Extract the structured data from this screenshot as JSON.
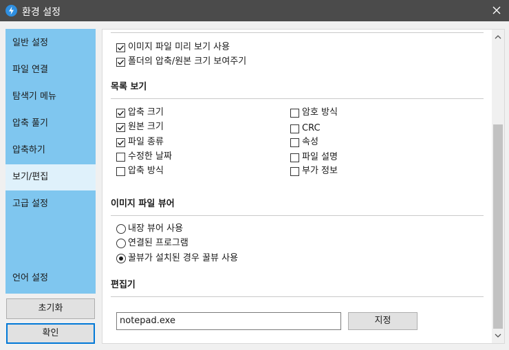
{
  "window": {
    "title": "환경 설정",
    "app_icon": "bandizip-icon",
    "close_icon": "close-icon"
  },
  "sidebar": {
    "items": [
      {
        "label": "일반 설정",
        "active": false
      },
      {
        "label": "파일 연결",
        "active": false
      },
      {
        "label": "탐색기 메뉴",
        "active": false
      },
      {
        "label": "압축 풀기",
        "active": false
      },
      {
        "label": "압축하기",
        "active": false
      },
      {
        "label": "보기/편집",
        "active": true
      },
      {
        "label": "고급 설정",
        "active": false
      }
    ],
    "language_label": "언어 설정",
    "reset_label": "초기화",
    "ok_label": "확인"
  },
  "preview": {
    "image_preview": {
      "label": "이미지 파일 미리 보기 사용",
      "checked": true
    },
    "folder_sizes": {
      "label": "폴더의 압축/원본 크기 보여주기",
      "checked": true
    }
  },
  "list_view": {
    "heading": "목록 보기",
    "left": [
      {
        "label": "압축 크기",
        "checked": true
      },
      {
        "label": "원본 크기",
        "checked": true
      },
      {
        "label": "파일 종류",
        "checked": true
      },
      {
        "label": "수정한 날짜",
        "checked": false
      },
      {
        "label": "압축 방식",
        "checked": false
      }
    ],
    "right": [
      {
        "label": "암호 방식",
        "checked": false
      },
      {
        "label": "CRC",
        "checked": false
      },
      {
        "label": "속성",
        "checked": false
      },
      {
        "label": "파일 설명",
        "checked": false
      },
      {
        "label": "부가 정보",
        "checked": false
      }
    ]
  },
  "image_viewer": {
    "heading": "이미지 파일 뷰어",
    "options": [
      {
        "label": "내장 뷰어 사용",
        "selected": false
      },
      {
        "label": "연결된 프로그램",
        "selected": false
      },
      {
        "label": "꿀뷰가 설치된 경우 꿀뷰 사용",
        "selected": true
      }
    ]
  },
  "editor": {
    "heading": "편집기",
    "value": "notepad.exe",
    "button_label": "지정"
  },
  "colors": {
    "titlebar": "#4b4b4b",
    "sidebar": "#7fc6ef",
    "sidebar_active": "#dff1fb"
  }
}
